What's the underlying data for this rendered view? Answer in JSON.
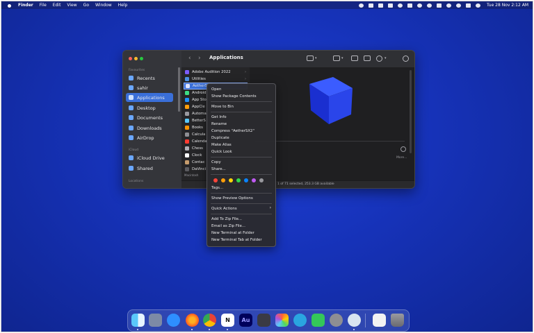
{
  "menubar": {
    "app": "Finder",
    "items": [
      "File",
      "Edit",
      "View",
      "Go",
      "Window",
      "Help"
    ],
    "datetime": "Tue 28 Nov 2:12 AM"
  },
  "finder": {
    "title": "Applications",
    "sidebar": {
      "favourites_header": "Favourites",
      "items": [
        "Recents",
        "sahir",
        "Applications",
        "Desktop",
        "Documents",
        "Downloads",
        "AirDrop"
      ],
      "icloud_header": "iCloud",
      "icloud_items": [
        "iCloud Drive",
        "Shared"
      ],
      "locations_header": "Locations"
    },
    "files": [
      "Adobe Audition 2022",
      "Utilities",
      "AetherSX2",
      "Android",
      "App Sto",
      "AppCle",
      "Automa",
      "BetterS",
      "Books",
      "Calcula",
      "Calenda",
      "Chess",
      "Clock",
      "Contac",
      "DaVinci"
    ],
    "path_label": "Macintosh",
    "status_text": "1 of 71 selected, 253.3 GB available",
    "preview_more": "More..."
  },
  "context_menu": {
    "items": [
      "Open",
      "Show Package Contents",
      "Move to Bin",
      "Get Info",
      "Rename",
      "Compress \"AetherSX2\"",
      "Duplicate",
      "Make Alias",
      "Quick Look",
      "Copy",
      "Share...",
      "Tags...",
      "Show Preview Options",
      "Quick Actions",
      "Add To Zip File...",
      "Email as Zip File...",
      "New Terminal at Folder",
      "New Terminal Tab at Folder"
    ],
    "tag_colors": [
      "#ff453a",
      "#ff9f0a",
      "#ffd60a",
      "#32d74b",
      "#0a84ff",
      "#bf5af2",
      "#98989d"
    ]
  },
  "dock": {
    "apps": [
      "Finder",
      "Launchpad",
      "Safari",
      "Firefox",
      "Chrome",
      "Notion",
      "Audition",
      "DaVinci Resolve",
      "Photos",
      "Telegram",
      "FaceTime",
      "System Settings",
      "QuickTime",
      "Preview",
      "Trash"
    ],
    "notion_glyph": "N",
    "audition_glyph": "Au"
  },
  "colors": {
    "accent": "#3a6fd8",
    "desktop": "#1632b8"
  }
}
